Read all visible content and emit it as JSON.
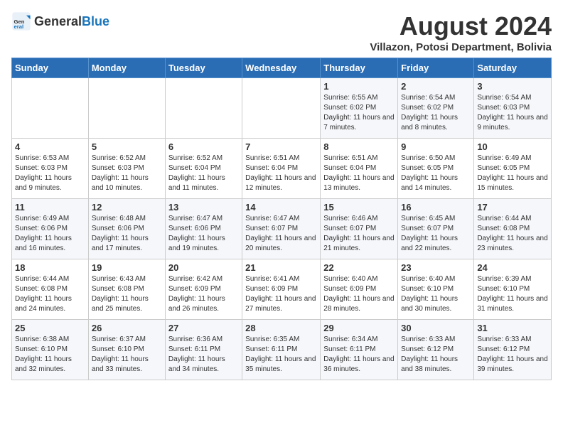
{
  "logo": {
    "general": "General",
    "blue": "Blue"
  },
  "title": "August 2024",
  "subtitle": "Villazon, Potosi Department, Bolivia",
  "days_header": [
    "Sunday",
    "Monday",
    "Tuesday",
    "Wednesday",
    "Thursday",
    "Friday",
    "Saturday"
  ],
  "weeks": [
    [
      {
        "num": "",
        "info": ""
      },
      {
        "num": "",
        "info": ""
      },
      {
        "num": "",
        "info": ""
      },
      {
        "num": "",
        "info": ""
      },
      {
        "num": "1",
        "info": "Sunrise: 6:55 AM\nSunset: 6:02 PM\nDaylight: 11 hours and 7 minutes."
      },
      {
        "num": "2",
        "info": "Sunrise: 6:54 AM\nSunset: 6:02 PM\nDaylight: 11 hours and 8 minutes."
      },
      {
        "num": "3",
        "info": "Sunrise: 6:54 AM\nSunset: 6:03 PM\nDaylight: 11 hours and 9 minutes."
      }
    ],
    [
      {
        "num": "4",
        "info": "Sunrise: 6:53 AM\nSunset: 6:03 PM\nDaylight: 11 hours and 9 minutes."
      },
      {
        "num": "5",
        "info": "Sunrise: 6:52 AM\nSunset: 6:03 PM\nDaylight: 11 hours and 10 minutes."
      },
      {
        "num": "6",
        "info": "Sunrise: 6:52 AM\nSunset: 6:04 PM\nDaylight: 11 hours and 11 minutes."
      },
      {
        "num": "7",
        "info": "Sunrise: 6:51 AM\nSunset: 6:04 PM\nDaylight: 11 hours and 12 minutes."
      },
      {
        "num": "8",
        "info": "Sunrise: 6:51 AM\nSunset: 6:04 PM\nDaylight: 11 hours and 13 minutes."
      },
      {
        "num": "9",
        "info": "Sunrise: 6:50 AM\nSunset: 6:05 PM\nDaylight: 11 hours and 14 minutes."
      },
      {
        "num": "10",
        "info": "Sunrise: 6:49 AM\nSunset: 6:05 PM\nDaylight: 11 hours and 15 minutes."
      }
    ],
    [
      {
        "num": "11",
        "info": "Sunrise: 6:49 AM\nSunset: 6:06 PM\nDaylight: 11 hours and 16 minutes."
      },
      {
        "num": "12",
        "info": "Sunrise: 6:48 AM\nSunset: 6:06 PM\nDaylight: 11 hours and 17 minutes."
      },
      {
        "num": "13",
        "info": "Sunrise: 6:47 AM\nSunset: 6:06 PM\nDaylight: 11 hours and 19 minutes."
      },
      {
        "num": "14",
        "info": "Sunrise: 6:47 AM\nSunset: 6:07 PM\nDaylight: 11 hours and 20 minutes."
      },
      {
        "num": "15",
        "info": "Sunrise: 6:46 AM\nSunset: 6:07 PM\nDaylight: 11 hours and 21 minutes."
      },
      {
        "num": "16",
        "info": "Sunrise: 6:45 AM\nSunset: 6:07 PM\nDaylight: 11 hours and 22 minutes."
      },
      {
        "num": "17",
        "info": "Sunrise: 6:44 AM\nSunset: 6:08 PM\nDaylight: 11 hours and 23 minutes."
      }
    ],
    [
      {
        "num": "18",
        "info": "Sunrise: 6:44 AM\nSunset: 6:08 PM\nDaylight: 11 hours and 24 minutes."
      },
      {
        "num": "19",
        "info": "Sunrise: 6:43 AM\nSunset: 6:08 PM\nDaylight: 11 hours and 25 minutes."
      },
      {
        "num": "20",
        "info": "Sunrise: 6:42 AM\nSunset: 6:09 PM\nDaylight: 11 hours and 26 minutes."
      },
      {
        "num": "21",
        "info": "Sunrise: 6:41 AM\nSunset: 6:09 PM\nDaylight: 11 hours and 27 minutes."
      },
      {
        "num": "22",
        "info": "Sunrise: 6:40 AM\nSunset: 6:09 PM\nDaylight: 11 hours and 28 minutes."
      },
      {
        "num": "23",
        "info": "Sunrise: 6:40 AM\nSunset: 6:10 PM\nDaylight: 11 hours and 30 minutes."
      },
      {
        "num": "24",
        "info": "Sunrise: 6:39 AM\nSunset: 6:10 PM\nDaylight: 11 hours and 31 minutes."
      }
    ],
    [
      {
        "num": "25",
        "info": "Sunrise: 6:38 AM\nSunset: 6:10 PM\nDaylight: 11 hours and 32 minutes."
      },
      {
        "num": "26",
        "info": "Sunrise: 6:37 AM\nSunset: 6:10 PM\nDaylight: 11 hours and 33 minutes."
      },
      {
        "num": "27",
        "info": "Sunrise: 6:36 AM\nSunset: 6:11 PM\nDaylight: 11 hours and 34 minutes."
      },
      {
        "num": "28",
        "info": "Sunrise: 6:35 AM\nSunset: 6:11 PM\nDaylight: 11 hours and 35 minutes."
      },
      {
        "num": "29",
        "info": "Sunrise: 6:34 AM\nSunset: 6:11 PM\nDaylight: 11 hours and 36 minutes."
      },
      {
        "num": "30",
        "info": "Sunrise: 6:33 AM\nSunset: 6:12 PM\nDaylight: 11 hours and 38 minutes."
      },
      {
        "num": "31",
        "info": "Sunrise: 6:33 AM\nSunset: 6:12 PM\nDaylight: 11 hours and 39 minutes."
      }
    ]
  ]
}
